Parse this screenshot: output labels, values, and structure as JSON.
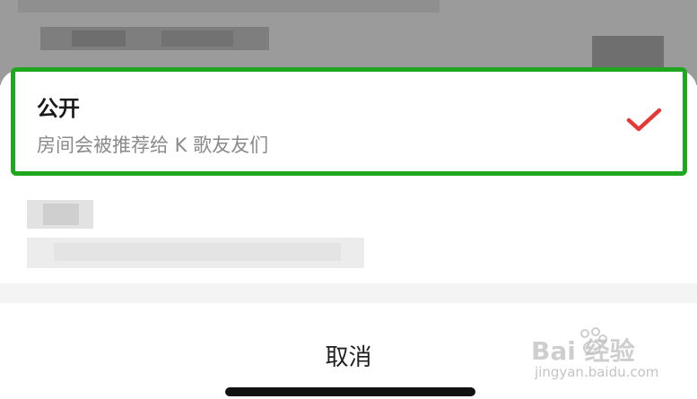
{
  "options": [
    {
      "title": "公开",
      "description": "房间会被推荐给 K 歌友友们",
      "selected": true,
      "check_icon": "checkmark-icon",
      "check_color": "#e53935"
    }
  ],
  "cancel_label": "取消",
  "accent": {
    "highlight_border": "#1fa81f"
  },
  "watermark": {
    "brand": "Bai 经验",
    "url": "jingyan.baidu.com"
  }
}
